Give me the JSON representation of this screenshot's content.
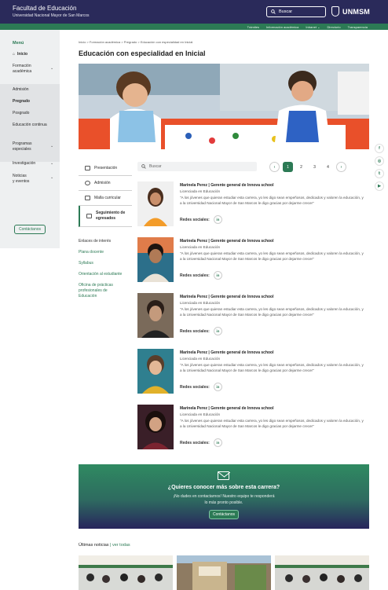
{
  "header": {
    "title": "Facultad de Educación",
    "subtitle": "Universidad Nacional Mayor de San Marcos",
    "search_label": "Buscar",
    "logo_text": "UNMSM"
  },
  "subnav": {
    "items": [
      "Trámites",
      "Información académica",
      "Intranet",
      "Directorio",
      "Transparencia"
    ]
  },
  "sidebar": {
    "menu_title": "Menú",
    "items": [
      {
        "label": "Inicio"
      },
      {
        "label": "Formación\nacadémica"
      },
      {
        "label": "Admisión"
      },
      {
        "label": "Pregrado"
      },
      {
        "label": "Posgrado"
      },
      {
        "label": "Educación continua"
      },
      {
        "label": "Programas\nespeciales"
      },
      {
        "label": "Investigación"
      },
      {
        "label": "Noticias\ny eventos"
      }
    ],
    "contact_button": "Contáctanos"
  },
  "breadcrumb": "Inicio  >  Formación académica  >  Pregrado  >  Educación con especialidad en Inicial",
  "page_title": "Educación con especialidad en Inicial",
  "program_nav": {
    "items": [
      {
        "label": "Presentación"
      },
      {
        "label": "Admisión"
      },
      {
        "label": "Malla curricular"
      },
      {
        "label": "Seguimiento de egresados"
      }
    ]
  },
  "interest": {
    "title": "Enlaces de interés",
    "links": [
      "Plana docente",
      "Syllabus",
      "Orientación al estudiante",
      "Oficina de prácticas profesionales de Educación"
    ]
  },
  "list": {
    "search_placeholder": "Buscar",
    "pages": [
      "1",
      "2",
      "3",
      "4"
    ],
    "current_page": "1"
  },
  "testimonials": [
    {
      "name": "Marinela Perez | Gerente general de Innova school",
      "role": "Licenciada en Educación",
      "quote": "\"A los jóvenes que quieran estudiar esta carrera, yo les digo sean empeñosos, dedicados y valoren la educación, y a la Universidad Nacional Mayor de San Marcos le digo gracias por dejarme crecer\"",
      "social_label": "Redes sociales:"
    },
    {
      "name": "Marinela Perez | Gerente general de Innova school",
      "role": "Licenciada en Educación",
      "quote": "\"A los jóvenes que quieran estudiar esta carrera, yo les digo sean empeñosos, dedicados y valoren la educación, y a la Universidad Nacional Mayor de San Marcos le digo gracias por dejarme crecer\"",
      "social_label": "Redes sociales:"
    },
    {
      "name": "Marinela Perez | Gerente general de Innova school",
      "role": "Licenciada en Educación",
      "quote": "\"A los jóvenes que quieran estudiar esta carrera, yo les digo sean empeñosos, dedicados y valoren la educación, y a la Universidad Nacional Mayor de San Marcos le digo gracias por dejarme crecer\"",
      "social_label": "Redes sociales:"
    },
    {
      "name": "Marinela Perez | Gerente general de Innova school",
      "role": "Licenciada en Educación",
      "quote": "\"A los jóvenes que quieran estudiar esta carrera, yo les digo sean empeñosos, dedicados y valoren la educación, y a la Universidad Nacional Mayor de San Marcos le digo gracias por dejarme crecer\"",
      "social_label": "Redes sociales:"
    },
    {
      "name": "Marinela Perez | Gerente general de Innova school",
      "role": "Licenciada en Educación",
      "quote": "\"A los jóvenes que quieran estudiar esta carrera, yo les digo sean empeñosos, dedicados y valoren la educación, y a la Universidad Nacional Mayor de San Marcos le digo gracias por dejarme crecer\"",
      "social_label": "Redes sociales:"
    }
  ],
  "cta": {
    "title": "¿Quieres conocer más sobre esta carrera?",
    "text": "¡No dudes en contactarnos! Nuestro equipo te responderá lo más pronto posible.",
    "button": "Contáctanos"
  },
  "news": {
    "title": "Últimas noticias",
    "see_all": "ver todas"
  },
  "colors": {
    "header_bg": "#2a2a5a",
    "accent_green": "#2c7a55",
    "sidebar_bg": "#eef0f1"
  }
}
